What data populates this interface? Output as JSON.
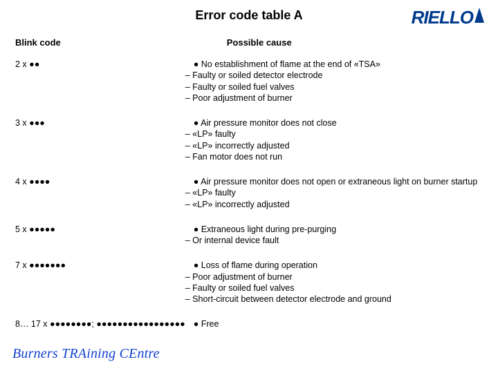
{
  "title": "Error code table A",
  "logo": "RIELLO",
  "footer": "Burners TRAining CEntre",
  "headers": {
    "blink": "Blink code",
    "cause": "Possible cause"
  },
  "rows": [
    {
      "code": "2 x ●●",
      "main": "● No establishment of flame at the end of «TSA»",
      "subs": [
        "– Faulty or soiled detector electrode",
        "– Faulty or soiled fuel valves",
        "– Poor adjustment of burner"
      ]
    },
    {
      "code": "3 x ●●●",
      "main": "● Air pressure monitor does not close",
      "subs": [
        "– «LP» faulty",
        "– «LP» incorrectly adjusted",
        "– Fan motor does not run"
      ]
    },
    {
      "code": "4 x ●●●●",
      "main": "● Air pressure monitor does not open or extraneous light on burner startup",
      "subs": [
        "– «LP» faulty",
        "– «LP» incorrectly adjusted"
      ]
    },
    {
      "code": "5 x ●●●●●",
      "main": "● Extraneous light during pre-purging",
      "subs": [
        "– Or internal device fault"
      ]
    },
    {
      "code": "7 x ●●●●●●●",
      "main": "● Loss of flame during operation",
      "subs": [
        "– Poor adjustment of burner",
        "– Faulty or soiled fuel valves",
        "– Short-circuit between detector electrode and ground"
      ]
    },
    {
      "code": "8… 17 x ●●●●●●●●; ●●●●●●●●●●●●●●●●●",
      "main": "● Free",
      "subs": []
    }
  ]
}
